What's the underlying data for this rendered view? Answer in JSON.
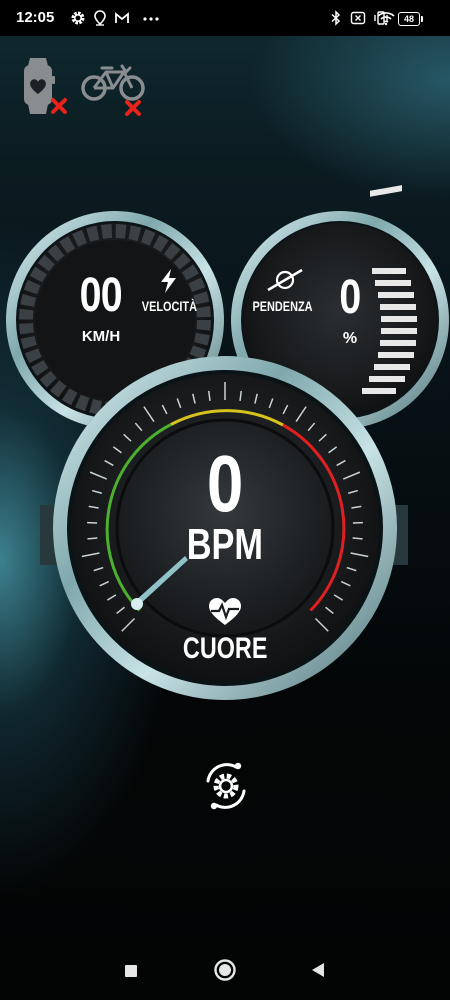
{
  "status_bar": {
    "time": "12:05",
    "battery": "48",
    "icons": [
      "settings-gear-icon",
      "location-pin-icon",
      "gmail-icon",
      "more-dots-icon",
      "bluetooth-icon",
      "screen-off-icon",
      "vibrate-icon",
      "wifi-icon",
      "battery-icon"
    ]
  },
  "devices": {
    "heart_monitor": {
      "icon": "smartwatch-heart-icon",
      "connected": false
    },
    "bike": {
      "icon": "bicycle-icon",
      "connected": false
    },
    "disconnected_color": "#e8231b"
  },
  "speed_gauge": {
    "value": "00",
    "unit": "KM/H",
    "label": "VELOCITÀ",
    "icon": "lightning-icon"
  },
  "slope_gauge": {
    "value": "0",
    "unit": "%",
    "label": "PENDENZA",
    "icon": "incline-icon"
  },
  "heart_gauge": {
    "value": "0",
    "unit": "BPM",
    "label": "CUORE",
    "icon": "heartbeat-icon",
    "level": 0
  },
  "action": {
    "icon": "gear-sync-icon"
  },
  "nav_bar": {
    "icons": [
      "recents-square-icon",
      "home-circle-icon",
      "back-triangle-icon"
    ]
  },
  "colors": {
    "bezel": "#9fc4c8",
    "zone_green": "#4caf2e",
    "zone_yellow": "#d8c21c",
    "zone_red": "#e02020",
    "needle": "#8fc3c8"
  }
}
